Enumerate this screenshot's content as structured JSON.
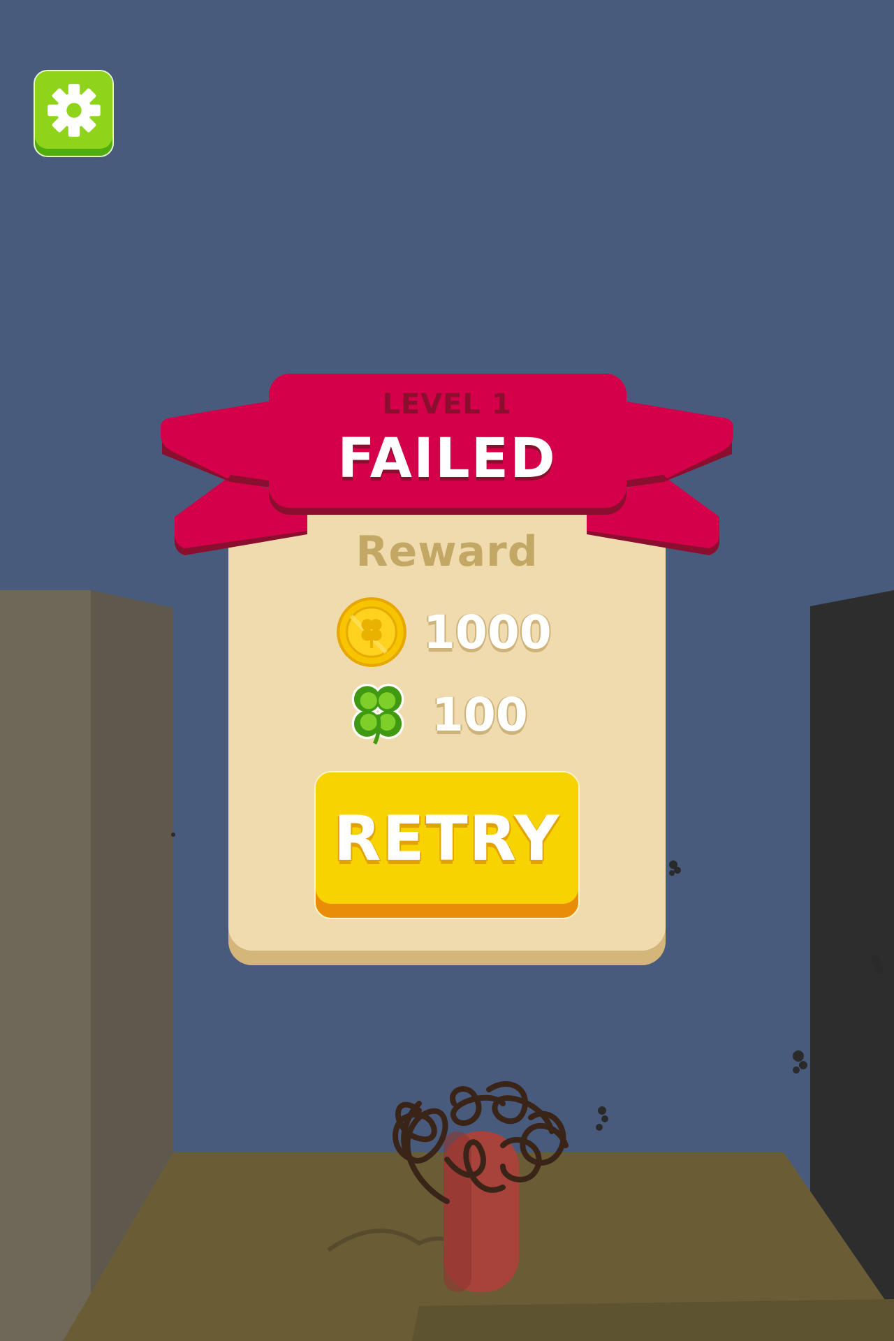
{
  "game": {
    "settings_icon": "gear-icon",
    "result": {
      "level_label": "LEVEL 1",
      "status_label": "FAILED",
      "reward_title": "Reward",
      "rewards": [
        {
          "icon": "coin-icon",
          "value": "1000"
        },
        {
          "icon": "clover-icon",
          "value": "100"
        }
      ],
      "retry_label": "RETRY"
    }
  },
  "colors": {
    "sky": "#485b7d",
    "ribbon": "#d5004a",
    "panel": "#efdbae",
    "retry_button": "#f7d301",
    "settings_button": "#8fd41a"
  }
}
